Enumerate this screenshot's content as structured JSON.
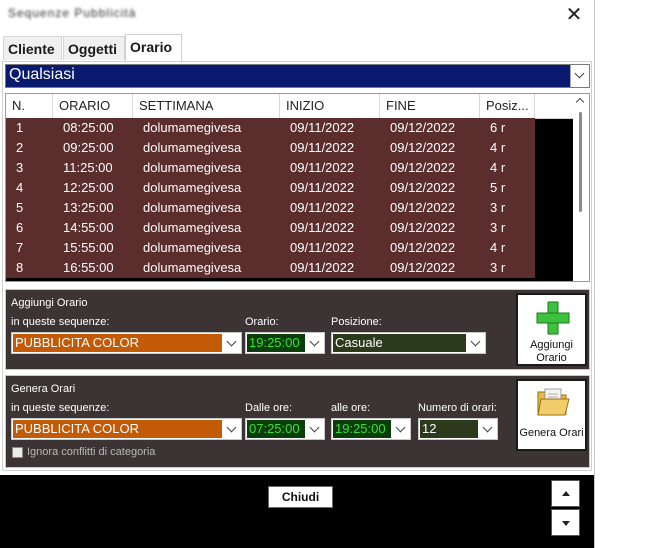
{
  "window": {
    "title": "Sequenze Pubblicità"
  },
  "tabs": [
    {
      "label": "Cliente"
    },
    {
      "label": "Oggetti"
    },
    {
      "label": "Orario"
    }
  ],
  "filter": {
    "value": "Qualsiasi"
  },
  "table": {
    "headers": [
      "N.",
      "ORARIO",
      "SETTIMANA",
      "INIZIO",
      "FINE",
      "Posiz..."
    ],
    "rows": [
      [
        "1",
        "08:25:00",
        "dolumamegivesa",
        "09/11/2022",
        "09/12/2022",
        "6 r"
      ],
      [
        "2",
        "09:25:00",
        "dolumamegivesa",
        "09/11/2022",
        "09/12/2022",
        "4 r"
      ],
      [
        "3",
        "11:25:00",
        "dolumamegivesa",
        "09/11/2022",
        "09/12/2022",
        "4 r"
      ],
      [
        "4",
        "12:25:00",
        "dolumamegivesa",
        "09/11/2022",
        "09/12/2022",
        "5 r"
      ],
      [
        "5",
        "13:25:00",
        "dolumamegivesa",
        "09/11/2022",
        "09/12/2022",
        "3 r"
      ],
      [
        "6",
        "14:55:00",
        "dolumamegivesa",
        "09/11/2022",
        "09/12/2022",
        "3 r"
      ],
      [
        "7",
        "15:55:00",
        "dolumamegivesa",
        "09/11/2022",
        "09/12/2022",
        "4 r"
      ],
      [
        "8",
        "16:55:00",
        "dolumamegivesa",
        "09/11/2022",
        "09/12/2022",
        "3 r"
      ]
    ]
  },
  "add_section": {
    "title": "Aggiungi Orario",
    "sequences_label": "in queste sequenze:",
    "sequence_value": "PUBBLICITA COLOR",
    "time_label": "Orario:",
    "time_value": "19:25:00",
    "position_label": "Posizione:",
    "position_value": "Casuale",
    "button_line1": "Aggiungi",
    "button_line2": "Orario"
  },
  "generate_section": {
    "title": "Genera Orari",
    "sequences_label": "in queste sequenze:",
    "sequence_value": "PUBBLICITA COLOR",
    "from_label": "Dalle ore:",
    "from_value": "07:25:00",
    "to_label": "alle ore:",
    "to_value": "19:25:00",
    "count_label": "Numero di orari:",
    "count_value": "12",
    "button_label": "Genera Orari",
    "ignore_label": "Ignora conflitti di categoria"
  },
  "footer": {
    "close_label": "Chiudi"
  },
  "colors": {
    "row_bg": "#5c2d2d",
    "sequence_bg": "#c25a06",
    "time_bg": "#0b3d0b",
    "time_fg": "#34e334",
    "position_bg": "#2a3a1a",
    "filter_bg": "#0a1a6e"
  }
}
